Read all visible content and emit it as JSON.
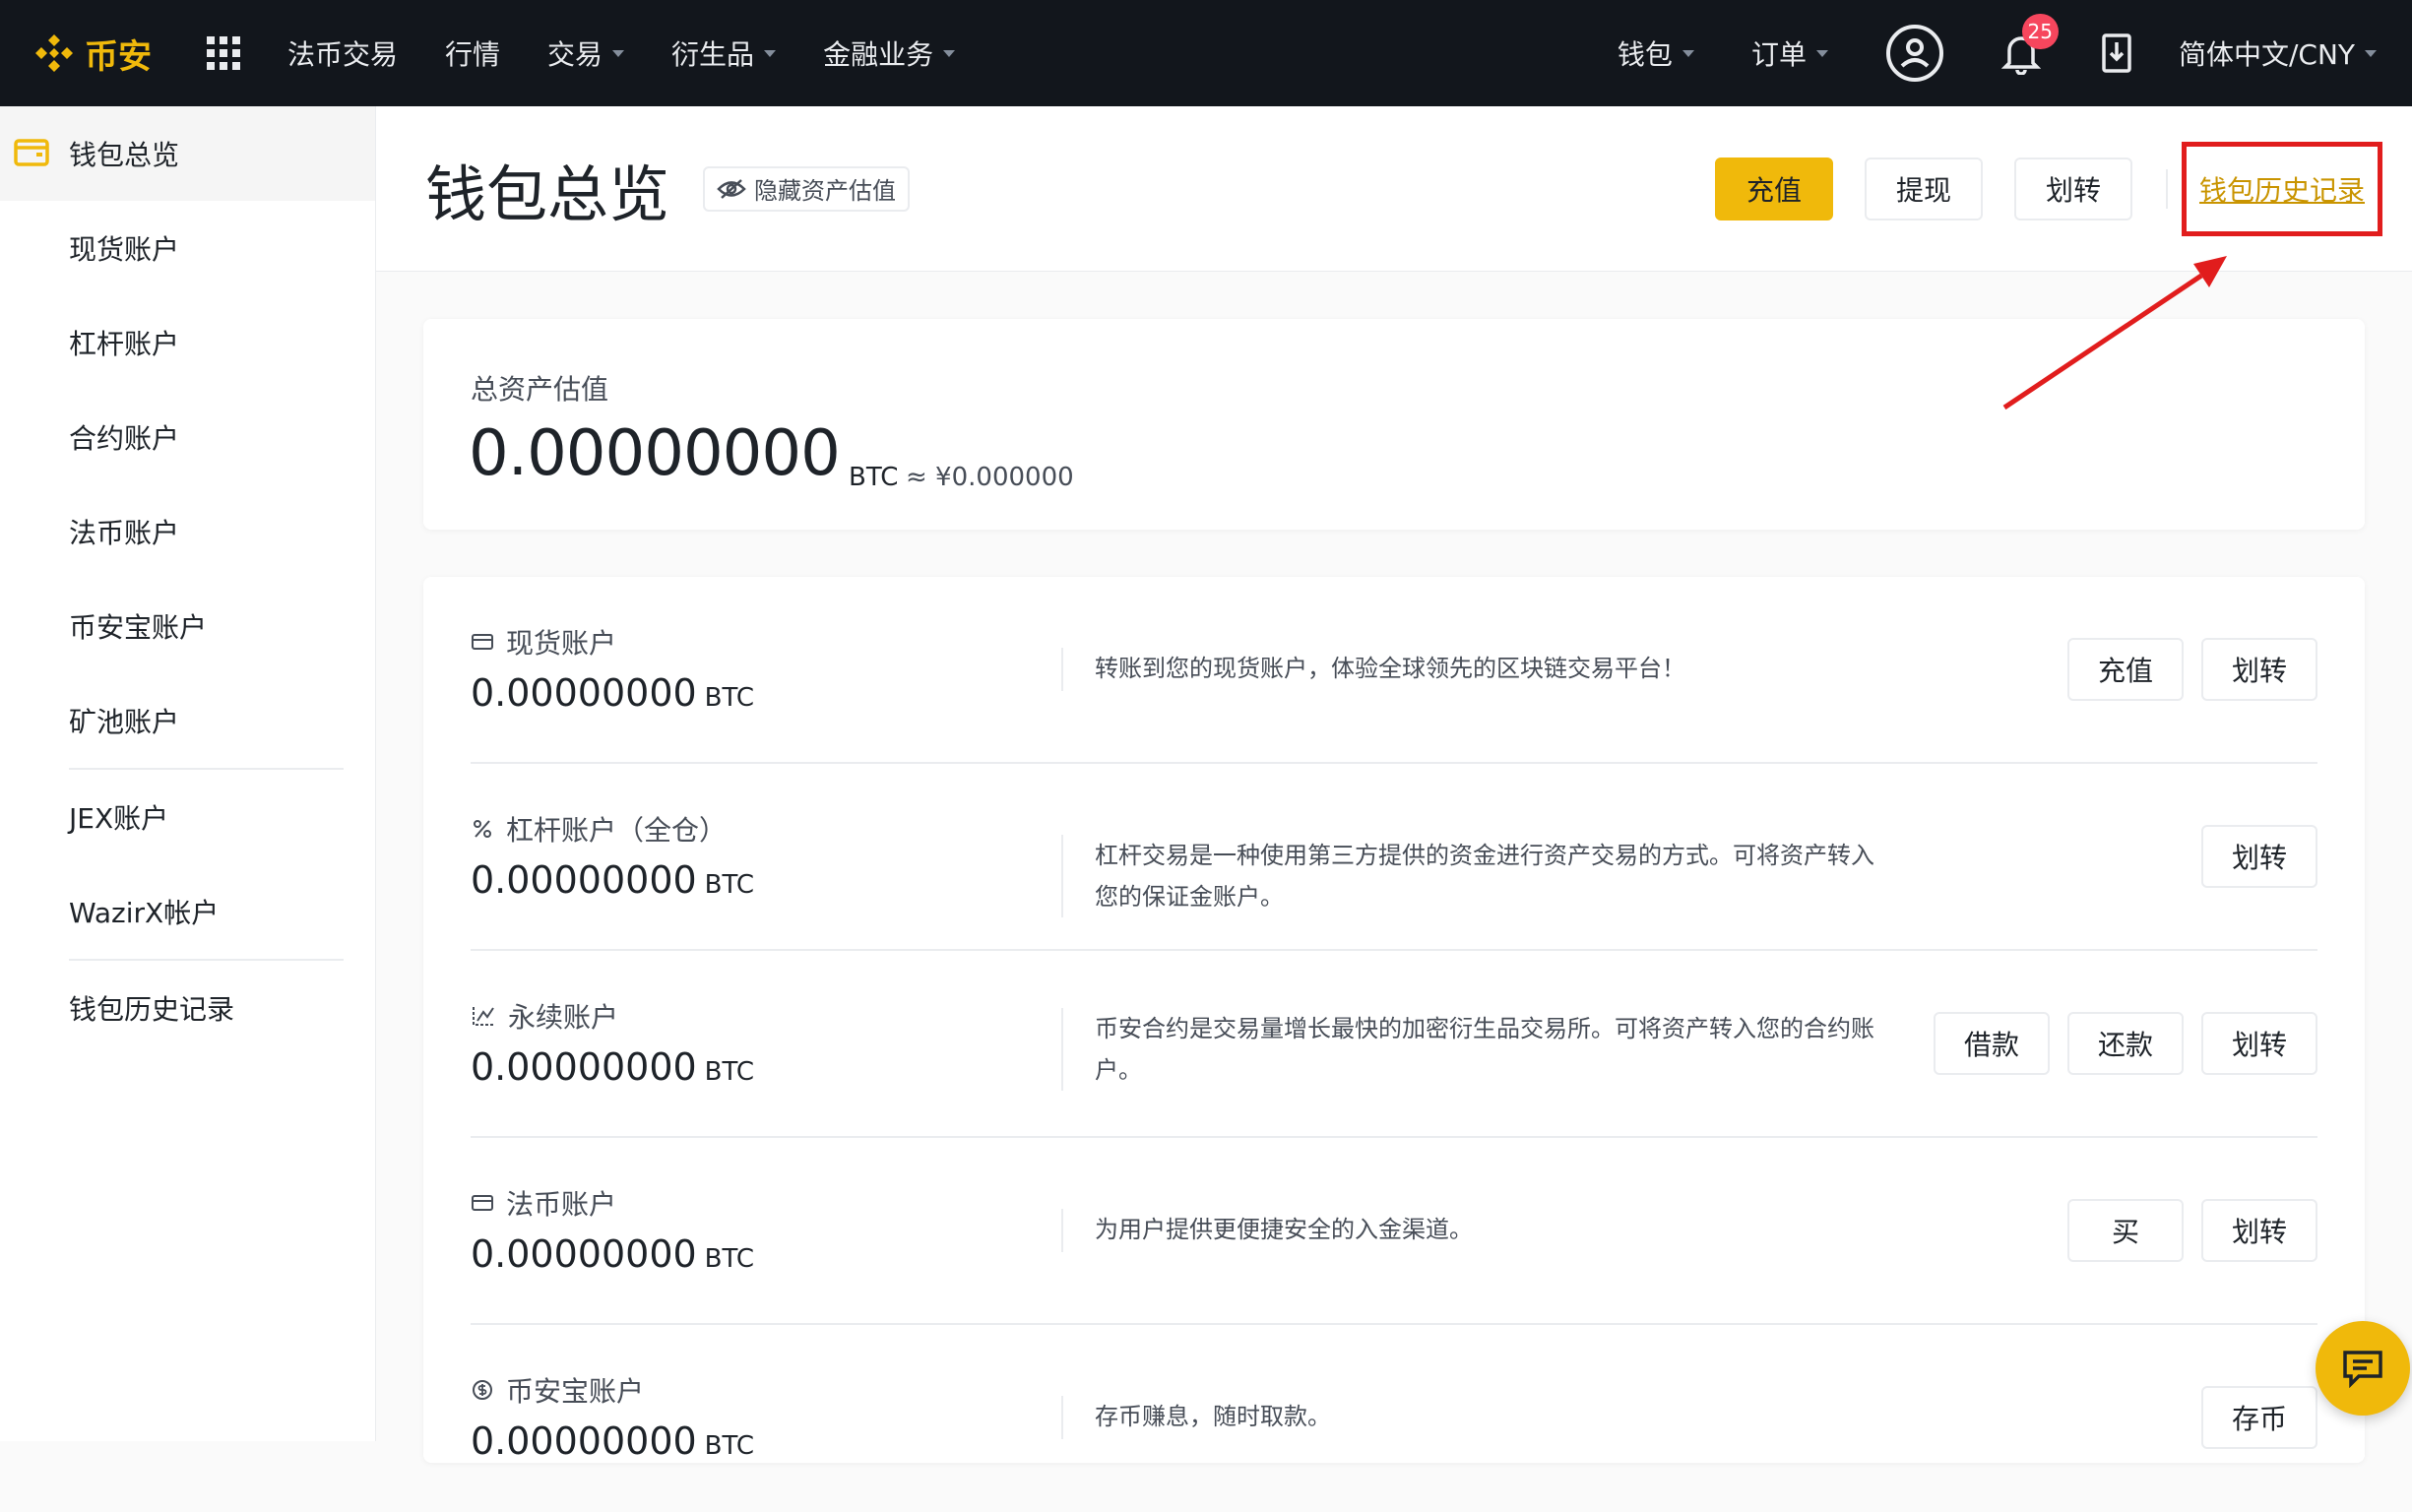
{
  "brand": {
    "logo_text": "币安",
    "color": "#f0b90b"
  },
  "topnav": {
    "left_items": [
      {
        "label": "法币交易",
        "caret": false
      },
      {
        "label": "行情",
        "caret": false
      },
      {
        "label": "交易",
        "caret": true
      },
      {
        "label": "衍生品",
        "caret": true
      },
      {
        "label": "金融业务",
        "caret": true
      }
    ],
    "wallet": "钱包",
    "orders": "订单",
    "notification_count": "25",
    "language": "简体中文/CNY"
  },
  "sidebar": {
    "items": [
      {
        "label": "钱包总览",
        "active": true
      },
      {
        "label": "现货账户"
      },
      {
        "label": "杠杆账户"
      },
      {
        "label": "合约账户"
      },
      {
        "label": "法币账户"
      },
      {
        "label": "币安宝账户"
      },
      {
        "label": "矿池账户"
      },
      {
        "label": "JEX账户"
      },
      {
        "label": "WazirX帐户"
      },
      {
        "label": "钱包历史记录"
      }
    ]
  },
  "header": {
    "title": "钱包总览",
    "hide_assets": "隐藏资产估值",
    "deposit": "充值",
    "withdraw": "提现",
    "transfer": "划转",
    "history_link": "钱包历史记录"
  },
  "total": {
    "label": "总资产估值",
    "value": "0.00000000",
    "unit": "BTC",
    "fiat": "≈ ¥0.000000"
  },
  "accounts": [
    {
      "name": "现货账户",
      "icon": "card-icon",
      "value": "0.00000000",
      "unit": "BTC",
      "desc": "转账到您的现货账户，体验全球领先的区块链交易平台！",
      "buttons": [
        "充值",
        "划转"
      ]
    },
    {
      "name": "杠杆账户（全仓）",
      "icon": "percent-icon",
      "value": "0.00000000",
      "unit": "BTC",
      "desc": "杠杆交易是一种使用第三方提供的资金进行资产交易的方式。可将资产转入您的保证金账户。",
      "buttons": [
        "划转"
      ]
    },
    {
      "name": "永续账户",
      "icon": "futures-icon",
      "value": "0.00000000",
      "unit": "BTC",
      "desc": "币安合约是交易量增长最快的加密衍生品交易所。可将资产转入您的合约账户。",
      "buttons": [
        "借款",
        "还款",
        "划转"
      ]
    },
    {
      "name": "法币账户",
      "icon": "card-icon",
      "value": "0.00000000",
      "unit": "BTC",
      "desc": "为用户提供更便捷安全的入金渠道。",
      "buttons": [
        "买",
        "划转"
      ]
    },
    {
      "name": "币安宝账户",
      "icon": "savings-icon",
      "value": "0.00000000",
      "unit": "BTC",
      "desc": "存币赚息，随时取款。",
      "buttons": [
        "存币"
      ]
    }
  ],
  "colors": {
    "accent": "#f0b90b",
    "link": "#c99400",
    "highlight": "#e11d1d",
    "nav_bg": "#12161c"
  }
}
